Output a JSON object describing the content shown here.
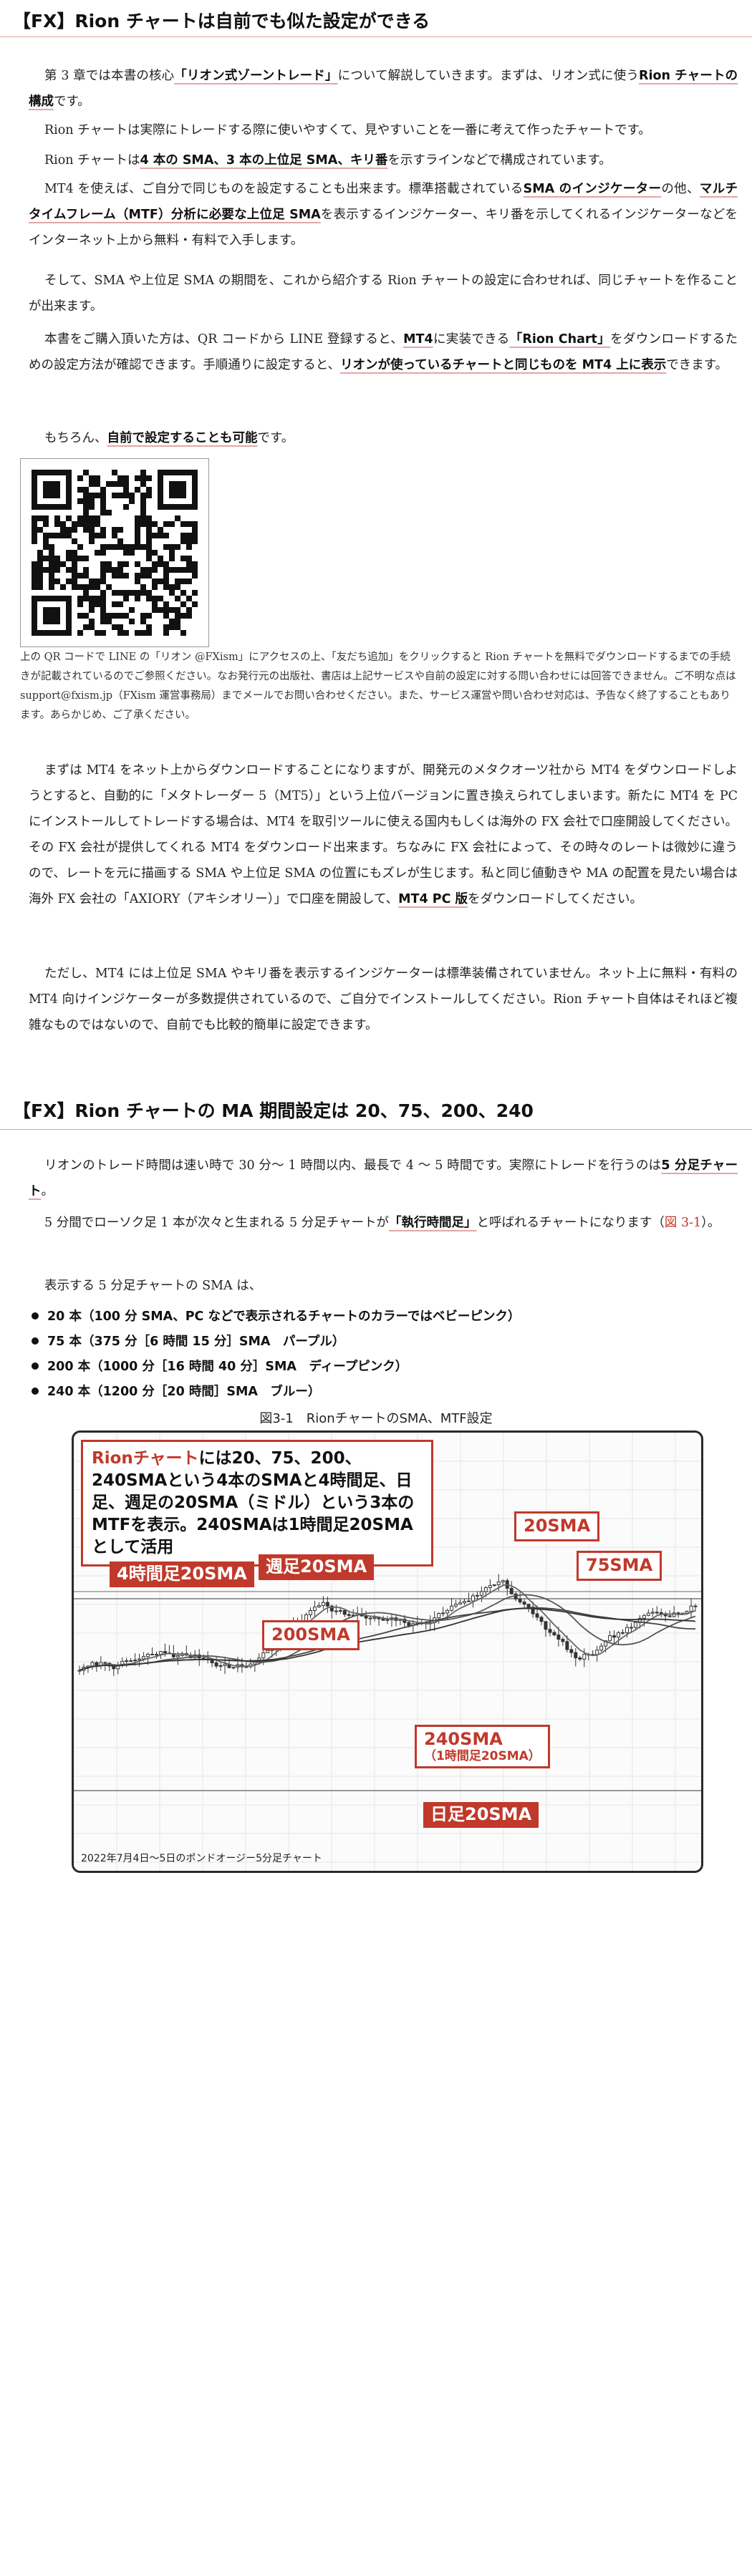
{
  "section1": {
    "title": "【FX】Rion チャートは自前でも似た設定ができる",
    "p1": {
      "a": "第 3 章では本書の核心",
      "b": "「リオン式ゾーントレード」",
      "c": "について解説していきます。まずは、リオン式に使う",
      "d": "Rion チャートの構成",
      "e": "です。"
    },
    "p2": "Rion チャートは実際にトレードする際に使いやすくて、見やすいことを一番に考えて作ったチャートです。",
    "p3": {
      "a": "Rion チャートは",
      "b": "4 本の SMA、3 本の上位足 SMA、キリ番",
      "c": "を示すラインなどで構成されています。"
    },
    "p4": {
      "a": "MT4 を使えば、ご自分で同じものを設定することも出来ます。標準搭載されている",
      "b": "SMA のインジケーター",
      "c": "の他、",
      "d": "マルチタイムフレーム（MTF）分析に必要な上位足 SMA",
      "e": "を表示するインジケーター、キリ番を示してくれるインジケーターなどをインターネット上から無料・有料で入手します。"
    },
    "p5": "そして、SMA や上位足 SMA の期間を、これから紹介する Rion チャートの設定に合わせれば、同じチャートを作ることが出来ます。",
    "p6": {
      "a": "本書をご購入頂いた方は、QR コードから LINE 登録すると、",
      "b": "MT4",
      "c": "に実装できる",
      "d": "「Rion Chart」",
      "e": "をダウンロードするための設定方法が確認できます。手順通りに設定すると、",
      "f": "リオンが使っているチャートと同じものを MT4 上に表示",
      "g": "できます。"
    },
    "p7": {
      "a": "もちろん、",
      "b": "自前で設定することも可能",
      "c": "です。"
    },
    "qr_note": "上の QR コードで LINE の「リオン @FXism」にアクセスの上、「友だち追加」をクリックすると Rion チャートを無料でダウンロードするまでの手続きが記載されているのでご参照ください。なお発行元の出版社、書店は上記サービスや自前の設定に対する問い合わせには回答できません。ご不明な点は support@fxism.jp（FXism 運営事務局）までメールでお問い合わせください。また、サービス運営や問い合わせ対応は、予告なく終了することもあります。あらかじめ、ご了承ください。",
    "p8": {
      "a": "まずは MT4 をネット上からダウンロードすることになりますが、開発元のメタクオーツ社から MT4 をダウンロードしようとすると、自動的に「メタトレーダー 5（MT5）」という上位バージョンに置き換えられてしまいます。新たに MT4 を PC にインストールしてトレードする場合は、MT4 を取引ツールに使える国内もしくは海外の FX 会社で口座開設してください。その FX 会社が提供してくれる MT4 をダウンロード出来ます。ちなみに FX 会社によって、その時々のレートは微妙に違うので、レートを元に描画する SMA や上位足 SMA の位置にもズレが生じます。私と同じ値動きや MA の配置を見たい場合は海外 FX 会社の「AXIORY（アキシオリー）」で口座を開設して、",
      "b": "MT4 PC 版",
      "c": "をダウンロードしてください。"
    },
    "p9": "ただし、MT4 には上位足 SMA やキリ番を表示するインジケーターは標準装備されていません。ネット上に無料・有料の MT4 向けインジケーターが多数提供されているので、ご自分でインストールしてください。Rion チャート自体はそれほど複雑なものではないので、自前でも比較的簡単に設定できます。"
  },
  "section2": {
    "title": "【FX】Rion チャートの MA 期間設定は 20、75、200、240",
    "p1": {
      "a": "リオンのトレード時間は速い時で 30 分～ 1 時間以内、最長で 4 ～ 5 時間です。実際にトレードを行うのは",
      "b": "5 分足チャート",
      "c": "。"
    },
    "p2": {
      "a": "5 分間でローソク足 1 本が次々と生まれる 5 分足チャートが",
      "b": "「執行時間足」",
      "c": "と呼ばれるチャートになります（",
      "d": "図 3-1",
      "e": "）。"
    },
    "p3": "表示する 5 分足チャートの SMA は、",
    "bullets": [
      "20 本（100 分 SMA、PC などで表示されるチャートのカラーではベビーピンク）",
      "75 本（375 分［6 時間 15 分］SMA　パープル）",
      "200 本（1000 分［16 時間 40 分］SMA　ディープピンク）",
      "240 本（1200 分［20 時間］SMA　ブルー）"
    ]
  },
  "figure": {
    "caption": "図3-1　RionチャートのSMA、MTF設定",
    "note_a": "Rionチャート",
    "note_b": "には20、75、200、240SMAという4本のSMAと4時間足、日足、週足の20SMA（ミドル）という3本のMTFを表示。240SMAは1時間足20SMAとして活用",
    "callouts": {
      "h4": "4時間足20SMA",
      "weekly": "週足20SMA",
      "sma20": "20SMA",
      "sma75": "75SMA",
      "sma200": "200SMA",
      "sma240": "240SMA",
      "sma240_sub": "（1時間足20SMA）",
      "daily": "日足20SMA"
    },
    "sublabel": "2022年7月4日〜5日のポンドオージー5分足チャート"
  },
  "colors": {
    "accent_red": "#c0392b",
    "rule": "#e0a59a",
    "underline": "#e4a5a5"
  }
}
